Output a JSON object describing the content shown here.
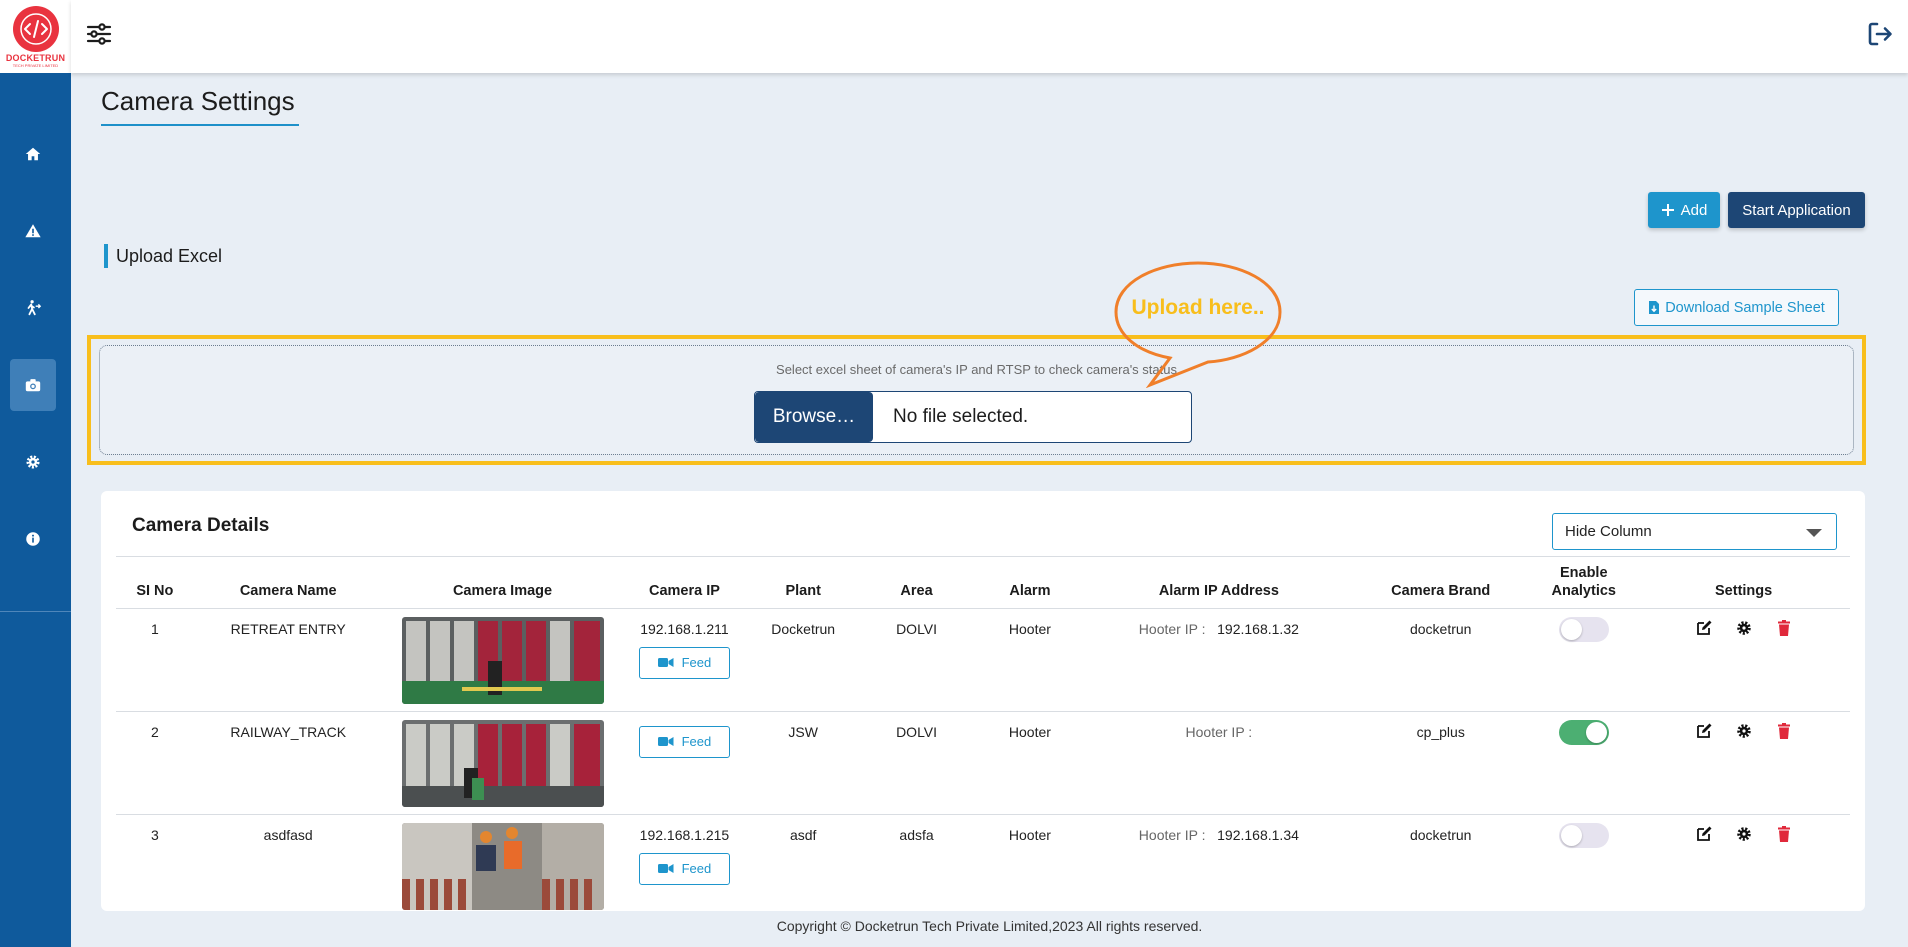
{
  "brand": {
    "name": "DOCKETRUN",
    "tagline": "TECH PRIVATE LIMITED",
    "primary_color": "#0f5a9c",
    "accent_color": "#1e95cc",
    "logo_color": "#e9333f"
  },
  "sidebar": {
    "items": [
      {
        "icon": "home-icon"
      },
      {
        "icon": "warning-icon"
      },
      {
        "icon": "person-walk-icon"
      },
      {
        "icon": "camera-icon",
        "active": true
      },
      {
        "icon": "gear-icon"
      },
      {
        "icon": "info-icon"
      }
    ]
  },
  "topbar": {
    "menu_icon": "sliders-icon",
    "logout_icon": "logout-icon"
  },
  "page": {
    "title": "Camera Settings"
  },
  "actions": {
    "add_label": "Add",
    "start_label": "Start Application",
    "sample_label": "Download Sample Sheet"
  },
  "upload": {
    "heading": "Upload Excel",
    "hint": "Select excel sheet of camera's IP and RTSP to check camera's status",
    "browse_label": "Browse…",
    "file_status": "No file selected.",
    "callout": "Upload here..",
    "highlight_color": "#f8be1c",
    "callout_color": "#f07f2a"
  },
  "details": {
    "title": "Camera Details",
    "hide_column_label": "Hide Column",
    "columns": [
      "SI No",
      "Camera Name",
      "Camera Image",
      "Camera IP",
      "Plant",
      "Area",
      "Alarm",
      "Alarm IP Address",
      "Camera Brand",
      "Enable Analytics",
      "Settings"
    ],
    "rows": [
      {
        "si": "1",
        "name": "RETREAT ENTRY",
        "ip": "192.168.1.211",
        "feed": "Feed",
        "plant": "Docketrun",
        "area": "DOLVI",
        "alarm": "Hooter",
        "hooter_label": "Hooter IP :",
        "hooter_ip": "192.168.1.32",
        "brand": "docketrun",
        "analytics": false
      },
      {
        "si": "2",
        "name": "RAILWAY_TRACK",
        "ip": "",
        "feed": "Feed",
        "plant": "JSW",
        "area": "DOLVI",
        "alarm": "Hooter",
        "hooter_label": "Hooter IP :",
        "hooter_ip": "",
        "brand": "cp_plus",
        "analytics": true
      },
      {
        "si": "3",
        "name": "asdfasd",
        "ip": "192.168.1.215",
        "feed": "Feed",
        "plant": "asdf",
        "area": "adsfa",
        "alarm": "Hooter",
        "hooter_label": "Hooter IP :",
        "hooter_ip": "192.168.1.34",
        "brand": "docketrun",
        "analytics": false
      }
    ]
  },
  "footer": {
    "text": "Copyright © Docketrun Tech Private Limited,2023 All rights reserved."
  }
}
